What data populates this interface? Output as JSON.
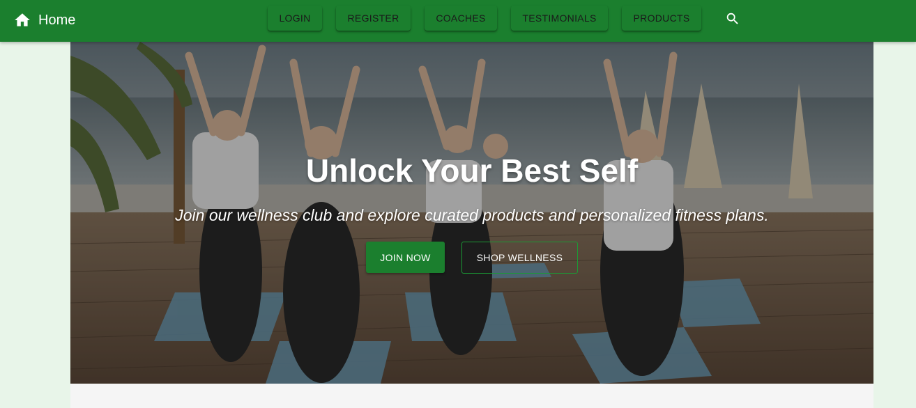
{
  "navbar": {
    "home_label": "Home",
    "links": [
      "LOGIN",
      "REGISTER",
      "COACHES",
      "TESTIMONIALS",
      "PRODUCTS"
    ],
    "home_icon": "home-icon",
    "search_icon": "search-icon"
  },
  "hero": {
    "title": "Unlock Your Best Self",
    "subtitle": "Join our wellness club and explore curated products and personalized fitness plans.",
    "primary_cta": "JOIN NOW",
    "secondary_cta": "SHOP WELLNESS"
  },
  "colors": {
    "brand_green": "#1b7f2e",
    "page_background": "#e8f5e9",
    "panel_background": "#f5f5f5"
  }
}
